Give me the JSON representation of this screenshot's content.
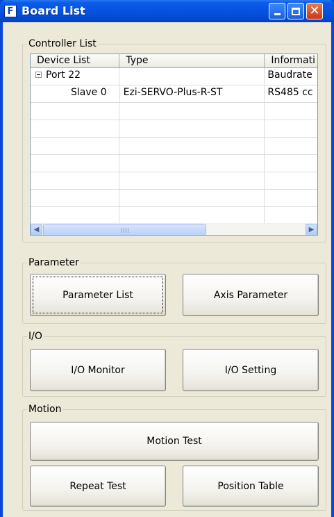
{
  "window": {
    "title": "Board List",
    "icon_letter": "F"
  },
  "controller_list": {
    "label": "Controller List",
    "columns": [
      "Device List",
      "Type",
      "Informati"
    ],
    "rows": [
      {
        "device": "Port 22",
        "type": "",
        "info": "Baudrate",
        "expanded": true,
        "indent": 0
      },
      {
        "device": "Slave 0",
        "type": "Ezi-SERVO-Plus-R-ST",
        "info": "RS485 cc",
        "indent": 1
      }
    ]
  },
  "parameter": {
    "label": "Parameter",
    "parameter_list": "Parameter List",
    "axis_parameter": "Axis Parameter"
  },
  "io": {
    "label": "I/O",
    "io_monitor": "I/O Monitor",
    "io_setting": "I/O Setting"
  },
  "motion": {
    "label": "Motion",
    "motion_test": "Motion Test",
    "repeat_test": "Repeat Test",
    "position_table": "Position Table"
  }
}
